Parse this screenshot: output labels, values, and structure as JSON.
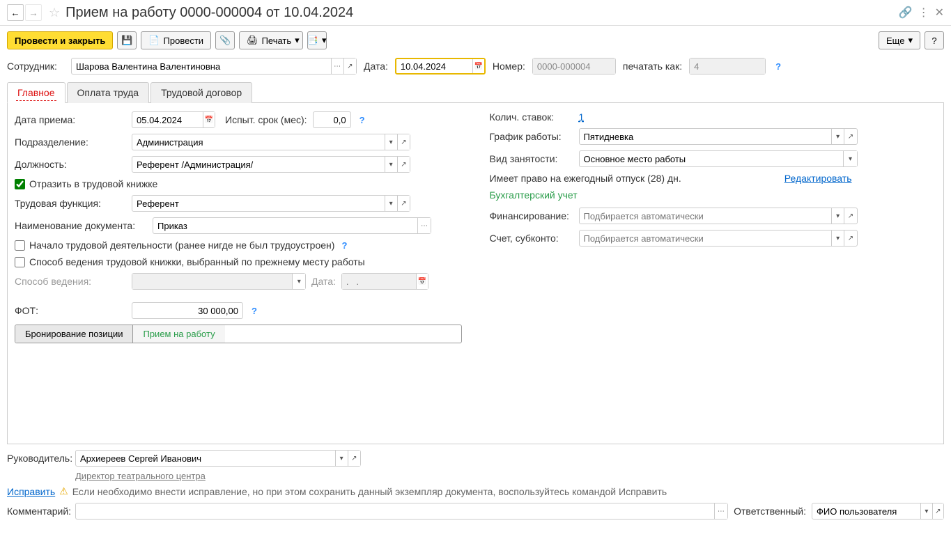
{
  "header": {
    "title": "Прием на работу 0000-000004 от 10.04.2024"
  },
  "toolbar": {
    "post_close": "Провести и закрыть",
    "post": "Провести",
    "print": "Печать",
    "more": "Еще"
  },
  "topform": {
    "employee_label": "Сотрудник:",
    "employee_value": "Шарова Валентина Валентиновна",
    "date_label": "Дата:",
    "date_value": "10.04.2024",
    "number_label": "Номер:",
    "number_value": "0000-000004",
    "print_as_label": "печатать как:",
    "print_as_value": "4"
  },
  "tabs": {
    "main": "Главное",
    "payment": "Оплата труда",
    "contract": "Трудовой договор"
  },
  "main": {
    "hire_date_label": "Дата приема:",
    "hire_date_value": "05.04.2024",
    "probation_label": "Испыт. срок (мес):",
    "probation_value": "0,0",
    "department_label": "Подразделение:",
    "department_value": "Администрация",
    "position_label": "Должность:",
    "position_value": "Референт /Администрация/",
    "reflect_checkbox": "Отразить в трудовой книжке",
    "labor_function_label": "Трудовая функция:",
    "labor_function_value": "Референт",
    "doc_name_label": "Наименование документа:",
    "doc_name_value": "Приказ",
    "first_job_checkbox": "Начало трудовой деятельности (ранее нигде не был трудоустроен)",
    "prev_method_checkbox": "Способ ведения трудовой книжки, выбранный по прежнему месту работы",
    "method_label": "Способ ведения:",
    "method_date_label": "Дата:",
    "method_date_placeholder": ".   .",
    "fot_label": "ФОТ:",
    "fot_value": "30 000,00",
    "booking_btn": "Бронирование позиции",
    "hire_btn": "Прием на работу",
    "rates_label": "Колич. ставок:",
    "rates_value": "1",
    "schedule_label": "График работы:",
    "schedule_value": "Пятидневка",
    "employment_label": "Вид занятости:",
    "employment_value": "Основное место работы",
    "vacation_text": "Имеет право на ежегодный отпуск (28) дн.",
    "edit_link": "Редактировать",
    "accounting_title": "Бухгалтерский учет",
    "financing_label": "Финансирование:",
    "financing_placeholder": "Подбирается автоматически",
    "account_label": "Счет, субконто:",
    "account_placeholder": "Подбирается автоматически"
  },
  "footer": {
    "manager_label": "Руководитель:",
    "manager_value": "Архиереев Сергей Иванович",
    "manager_position": "Директор театрального центра",
    "fix_link": "Исправить",
    "warning_text": "Если необходимо внести исправление, но при этом сохранить данный экземпляр документа, воспользуйтесь командой Исправить",
    "comment_label": "Комментарий:",
    "responsible_label": "Ответственный:",
    "responsible_value": "ФИО пользователя"
  }
}
